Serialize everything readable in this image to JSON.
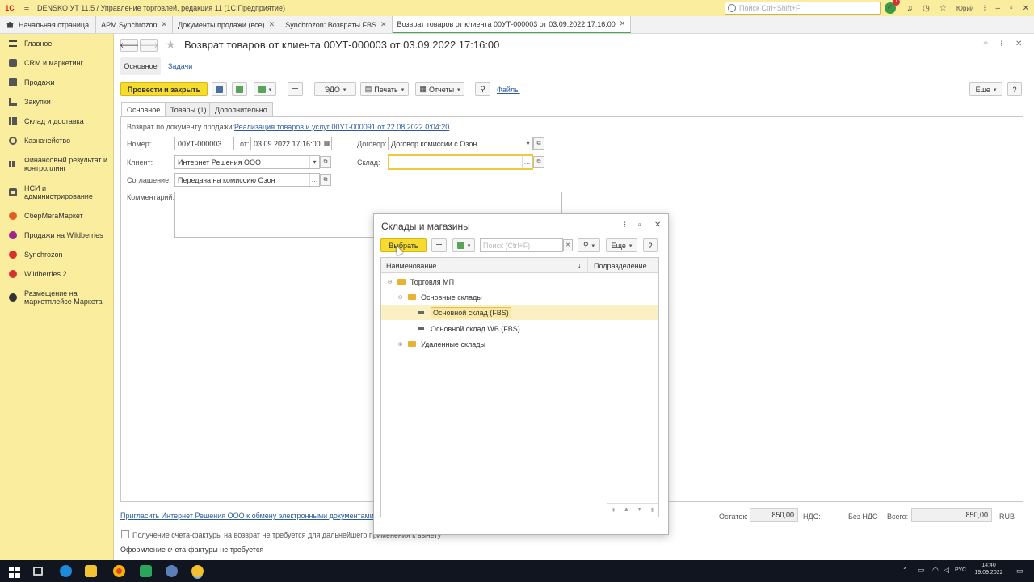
{
  "titlebar": {
    "app_title": "DENSKO УТ 11.5 / Управление торговлей, редакция 11  (1С:Предприятие)",
    "search_placeholder": "Поиск Ctrl+Shift+F",
    "notifications_count": "1",
    "user": "Юрий"
  },
  "tabs": {
    "home": "Начальная страница",
    "items": [
      {
        "label": "АРМ Synchrozon"
      },
      {
        "label": "Документы продажи (все)"
      },
      {
        "label": "Synchrozon: Возвраты FBS"
      },
      {
        "label": "Возврат товаров от клиента 00УТ-000003 от 03.09.2022 17:16:00"
      }
    ]
  },
  "sidebar": {
    "items": [
      {
        "label": "Главное",
        "icon": "menu-icon"
      },
      {
        "label": "CRM и маркетинг",
        "icon": "crm-icon"
      },
      {
        "label": "Продажи",
        "icon": "sales-icon"
      },
      {
        "label": "Закупки",
        "icon": "cart-icon"
      },
      {
        "label": "Склад и доставка",
        "icon": "warehouse-icon"
      },
      {
        "label": "Казначейство",
        "icon": "treasury-icon"
      },
      {
        "label": "Финансовый результат и контроллинг",
        "icon": "finance-icon"
      },
      {
        "label": "НСИ и администрирование",
        "icon": "settings-icon"
      },
      {
        "label": "СберМегаМаркет",
        "icon": "sber-icon"
      },
      {
        "label": "Продажи на Wildberries",
        "icon": "wildberries-icon"
      },
      {
        "label": "Synchrozon",
        "icon": "synchrozon-icon"
      },
      {
        "label": "Wildberries 2",
        "icon": "wildberries2-icon"
      },
      {
        "label": "Размещение на маркетплейсе Маркета",
        "icon": "market-icon"
      }
    ]
  },
  "form": {
    "title": "Возврат товаров от клиента 00УТ-000003 от 03.09.2022 17:16:00",
    "nav": {
      "main": "Основное",
      "tasks": "Задачи"
    },
    "toolbar": {
      "post_close": "Провести и закрыть",
      "edo": "ЭДО",
      "print": "Печать",
      "reports": "Отчеты",
      "files": "Файлы",
      "more": "Еще",
      "help": "?"
    },
    "tabs": {
      "main": "Основное",
      "goods": "Товары (1)",
      "extra": "Дополнительно"
    },
    "base_doc_label": "Возврат по документу продажи:",
    "base_doc_link": "Реализация товаров и услуг 00УТ-000091 от 22.08.2022 0:04:20",
    "number_label": "Номер:",
    "number_value": "00УТ-000003",
    "date_label": "от:",
    "date_value": "03.09.2022 17:16:00",
    "contract_label": "Договор:",
    "contract_value": "Договор комиссии с Озон",
    "client_label": "Клиент:",
    "client_value": "Интернет Решения ООО",
    "warehouse_label": "Склад:",
    "warehouse_value": "",
    "agreement_label": "Соглашение:",
    "agreement_value": "Передача на комиссию Озон",
    "comment_label": "Комментарий:",
    "invite_link": "Пригласить Интернет Решения ООО к обмену электронными документами в 1",
    "invoice_checkbox": "Получение счета-фактуры на возврат не требуется для дальнейшего применения к вычету",
    "invoice_status": "Оформление счета-фактуры не требуется",
    "summary": {
      "remainder_label": "Остаток:",
      "remainder_value": "850,00",
      "vat_label": "НДС:",
      "vat_value": "Без НДС",
      "total_label": "Всего:",
      "total_value": "850,00",
      "currency": "RUB"
    }
  },
  "modal": {
    "title": "Склады и магазины",
    "select_button": "Выбрать",
    "search_placeholder": "Поиск (Ctrl+F)",
    "more": "Еще",
    "help": "?",
    "columns": {
      "name": "Наименование",
      "sort": "↓",
      "department": "Подразделение"
    },
    "rows": [
      {
        "label": "Торговля МП",
        "expander": "⊖",
        "level": 0,
        "kind": "folder"
      },
      {
        "label": "Основные склады",
        "expander": "⊖",
        "level": 1,
        "kind": "folder"
      },
      {
        "label": "Основной склад (FBS)",
        "expander": "",
        "level": 2,
        "kind": "item",
        "selected": true
      },
      {
        "label": "Основной склад WB (FBS)",
        "expander": "",
        "level": 2,
        "kind": "item"
      },
      {
        "label": "Удаленные склады",
        "expander": "⊕",
        "level": 1,
        "kind": "folder"
      }
    ]
  },
  "taskbar": {
    "lang": "РУС",
    "time": "14:40",
    "date": "19.09.2022"
  },
  "colors": {
    "accent_yellow": "#fbed9e",
    "button_yellow": "#f5dc2e",
    "active_tab_green": "#48a85a",
    "link_blue": "#2d5c9c"
  }
}
